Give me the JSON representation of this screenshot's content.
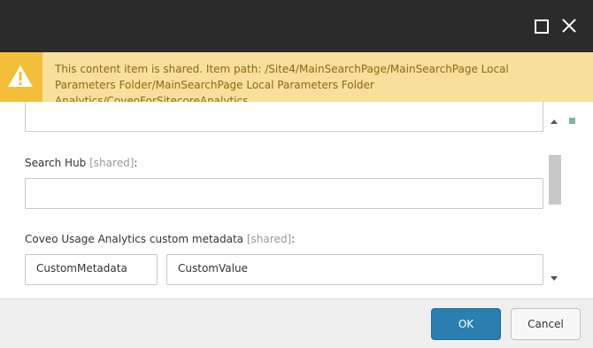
{
  "window": {
    "maximize_icon": "maximize-icon",
    "close_icon": "close-icon",
    "titlebar_color": "#2b2b2b"
  },
  "warning": {
    "icon": "warning-icon",
    "text": "This content item is shared. Item path: /Site4/MainSearchPage/MainSearchPage Local Parameters Folder/MainSearchPage Local Parameters Folder Analytics/CoveoForSitecoreAnalytics",
    "background": "#f8df9c"
  },
  "form": {
    "top_field_value": "",
    "search_hub": {
      "label": "Search Hub",
      "shared_tag": "[shared]",
      "suffix": ":",
      "value": ""
    },
    "custom_metadata": {
      "label": "Coveo Usage Analytics custom metadata",
      "shared_tag": "[shared]",
      "suffix": ":",
      "key_value": "CustomMetadata",
      "value_value": "CustomValue"
    }
  },
  "footer": {
    "ok_label": "OK",
    "cancel_label": "Cancel",
    "accent": "#2a7fb0"
  }
}
